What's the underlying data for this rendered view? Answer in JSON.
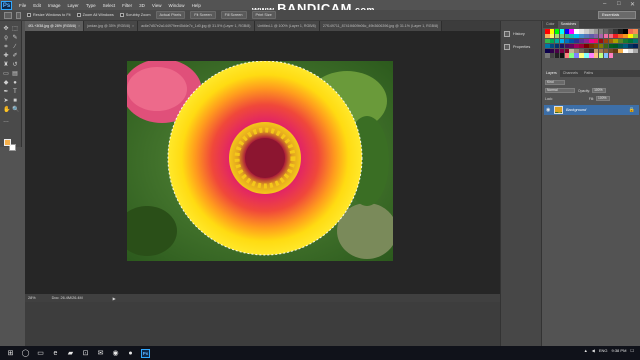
{
  "watermark": {
    "www": "www.",
    "brand": "BANDICAM",
    "tld": ".com"
  },
  "menu": [
    "File",
    "Edit",
    "Image",
    "Layer",
    "Type",
    "Select",
    "Filter",
    "3D",
    "View",
    "Window",
    "Help"
  ],
  "options": {
    "resize_windows_label": "Resize Windows to Fit",
    "zoom_all_windows_label": "Zoom All Windows",
    "scrubby_zoom_label": "Scrubby Zoom",
    "actual_pixels_label": "Actual Pixels",
    "fit_screen_label": "Fit Screen",
    "fill_screen_label": "Fill Screen",
    "print_size_label": "Print Size",
    "workspace_value": "Essentials"
  },
  "tabs": [
    {
      "label": "4f3-+3f38.jpg @ 28% (RGB/8)",
      "active": true
    },
    {
      "label": "jordan.jpg @ 35% (RGB/8)",
      "active": false
    },
    {
      "label": "ac6e7d57e2a144979ee45d4e7c_1d0.jpg @ 31.5% (Layer 1, RGB/8)",
      "active": false
    },
    {
      "label": "Untitled-1 @ 100% (Layer 1, RGB/8)",
      "active": false
    },
    {
      "label": "27f149711_8741f4609b06c_49b3606396.jpg @ 31.1% (Layer 1, RGB/8)",
      "active": false
    }
  ],
  "status": {
    "zoom": "28%",
    "doc": "Doc: 26.4M/26.4M",
    "arrow": "▶"
  },
  "mini_panel": {
    "history": "History",
    "properties": "Properties"
  },
  "swatch_panel": {
    "tab1": "Color",
    "tab2": "Swatches"
  },
  "layers_panel": {
    "tabs": [
      "Layers",
      "Channels",
      "Paths"
    ],
    "kind": "Kind",
    "blend": "Normal",
    "opacity_label": "Opacity:",
    "opacity_value": "100%",
    "lock_label": "Lock:",
    "fill_label": "Fill:",
    "fill_value": "100%",
    "layer_name": "Background"
  },
  "taskbar": {
    "time": "9:38 PM",
    "date": "3/2/2017",
    "lang": "ENG"
  },
  "colors": {
    "foreground": "#f5b04c",
    "background": "#ffffff",
    "layer_selected": "#3d6fa8",
    "accent": "#31a8ff"
  },
  "swatches": [
    "#ff0000",
    "#ffff00",
    "#00ff00",
    "#00ffff",
    "#0000ff",
    "#ff00ff",
    "#ffffff",
    "#e6e6e6",
    "#cccccc",
    "#b3b3b3",
    "#999999",
    "#808080",
    "#666666",
    "#4d4d4d",
    "#333333",
    "#1a1a1a",
    "#000000",
    "#f26c4f",
    "#f68e55",
    "#fbaf5c",
    "#fff467",
    "#acd372",
    "#7cc576",
    "#3bb878",
    "#1abbb4",
    "#00bff3",
    "#438ccb",
    "#5574b9",
    "#605ca8",
    "#855fa8",
    "#a763a9",
    "#ef6ea8",
    "#f16d7e",
    "#ee1d24",
    "#f16522",
    "#f7941d",
    "#fff100",
    "#8fc63d",
    "#37b44a",
    "#00a650",
    "#00a99e",
    "#00aeef",
    "#0072bc",
    "#0054a5",
    "#2f3192",
    "#652c91",
    "#91278f",
    "#ed008c",
    "#ee105a",
    "#9d0a0e",
    "#a0410d",
    "#a36209",
    "#aba000",
    "#598527",
    "#1a7b30",
    "#007236",
    "#00736a",
    "#0076a4",
    "#004a80",
    "#003370",
    "#1d1363",
    "#450e61",
    "#62055f",
    "#9e005c",
    "#9d0039",
    "#790000",
    "#7b3000",
    "#7c4900",
    "#827a00",
    "#3e6617",
    "#045f20",
    "#005824",
    "#005951",
    "#005b7e",
    "#003562",
    "#002056",
    "#0c004b",
    "#30004a",
    "#4b0048",
    "#7a0045",
    "#7a0026",
    "#c7b299",
    "#998675",
    "#736357",
    "#534741",
    "#37302d",
    "#c69c6d",
    "#a67c52",
    "#8c6239",
    "#754c24",
    "#603813",
    "#f5b04c",
    "#ffffff",
    "#dddddd",
    "#aaaaaa",
    "#777777",
    "#444444",
    "#222222",
    "#111111",
    "#ff8080",
    "#80ff80",
    "#8080ff",
    "#ffff80",
    "#80ffff",
    "#ff80ff",
    "#ffc080",
    "#c0ff80",
    "#80c0ff",
    "#ff80c0"
  ],
  "icons": {
    "tools": [
      "move-icon",
      "marquee-icon",
      "lasso-icon",
      "quick-select-icon",
      "crop-icon",
      "eyedropper-icon",
      "healing-icon",
      "brush-icon",
      "stamp-icon",
      "history-brush-icon",
      "eraser-icon",
      "gradient-icon",
      "blur-icon",
      "dodge-icon",
      "pen-icon",
      "type-icon",
      "path-select-icon",
      "shape-icon",
      "hand-icon",
      "zoom-icon"
    ]
  }
}
